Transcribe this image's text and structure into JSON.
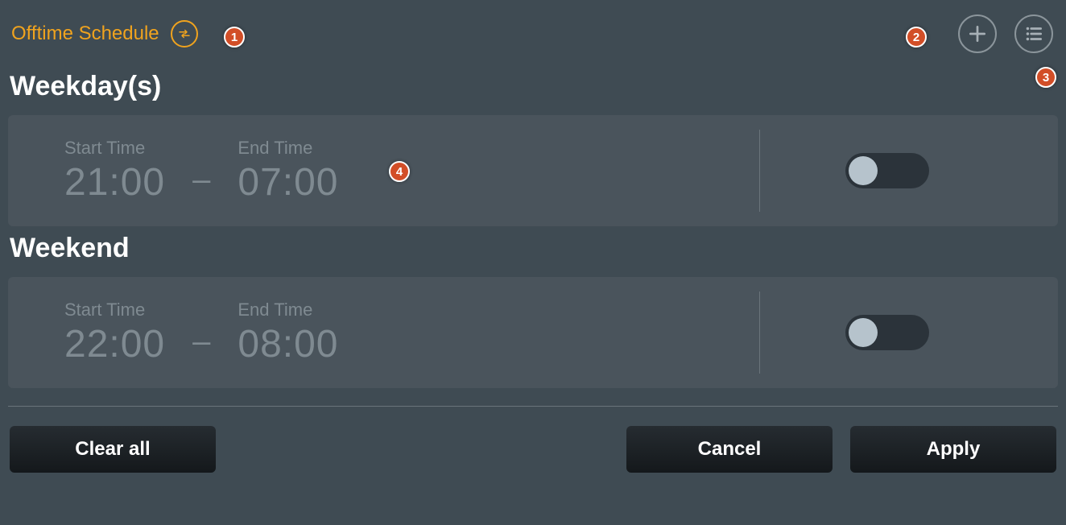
{
  "header": {
    "title": "Offtime Schedule",
    "swap_icon": "swap-horizontal-icon",
    "add_icon": "plus-icon",
    "list_icon": "list-icon"
  },
  "sections": [
    {
      "title": "Weekday(s)",
      "start_label": "Start Time",
      "start_value": "21:00",
      "end_label": "End Time",
      "end_value": "07:00",
      "toggle_on": false
    },
    {
      "title": "Weekend",
      "start_label": "Start Time",
      "start_value": "22:00",
      "end_label": "End Time",
      "end_value": "08:00",
      "toggle_on": false
    }
  ],
  "footer": {
    "clear": "Clear all",
    "cancel": "Cancel",
    "apply": "Apply"
  },
  "annotations": {
    "b1": "1",
    "b2": "2",
    "b3": "3",
    "b4": "4"
  }
}
